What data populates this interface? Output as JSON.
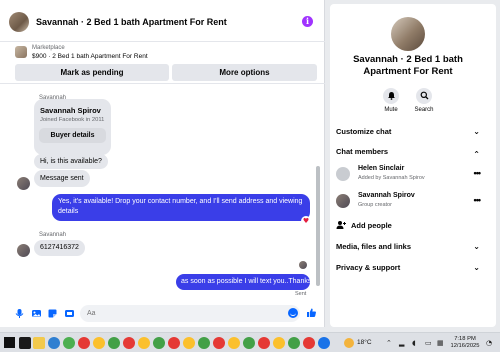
{
  "header": {
    "title": "Savannah · 2 Bed 1 bath Apartment For Rent",
    "info_icon": "i"
  },
  "marketplace": {
    "label": "Marketplace",
    "item": "$900 · 2 Bed 1 bath Apartment For Rent",
    "mark_pending": "Mark as pending",
    "more_options": "More options"
  },
  "messages": {
    "sender1": "Savannah",
    "card_name": "Savannah Spirov",
    "card_sub": "Joined Facebook in 2011",
    "card_button": "Buyer details",
    "msg_available": "Hi, is this available?",
    "msg_sent": "Message sent",
    "msg_reply": "Yes, it's available! Drop your contact number, and I'll send address and viewing details",
    "sender2": "Savannah",
    "msg_number": "6127416372",
    "msg_last": "as soon as possible I will text you..Thanks",
    "status": "Sent",
    "heart": "♥"
  },
  "composer": {
    "placeholder": "Aa",
    "like": "👍"
  },
  "info_panel": {
    "title": "Savannah · 2 Bed 1 bath Apartment For Rent",
    "mute": "Mute",
    "search": "Search",
    "customize_chat": "Customize chat",
    "chat_members": "Chat members",
    "members": [
      {
        "name": "Helen Sinclair",
        "sub": "Added by Savannah Spirov"
      },
      {
        "name": "Savannah Spirov",
        "sub": "Group creator"
      }
    ],
    "add_people": "Add people",
    "media_files": "Media, files and links",
    "privacy_support": "Privacy & support",
    "chevron_down": "⌄",
    "chevron_up": "⌃",
    "more_dots": "•••"
  },
  "taskbar": {
    "temperature": "18°C",
    "time": "7:18 PM",
    "date": "12/16/2025"
  },
  "colors": {
    "accent": "#0866ff",
    "sent_bubble": "#3a3ee8",
    "info_icon": "#a033ff"
  }
}
